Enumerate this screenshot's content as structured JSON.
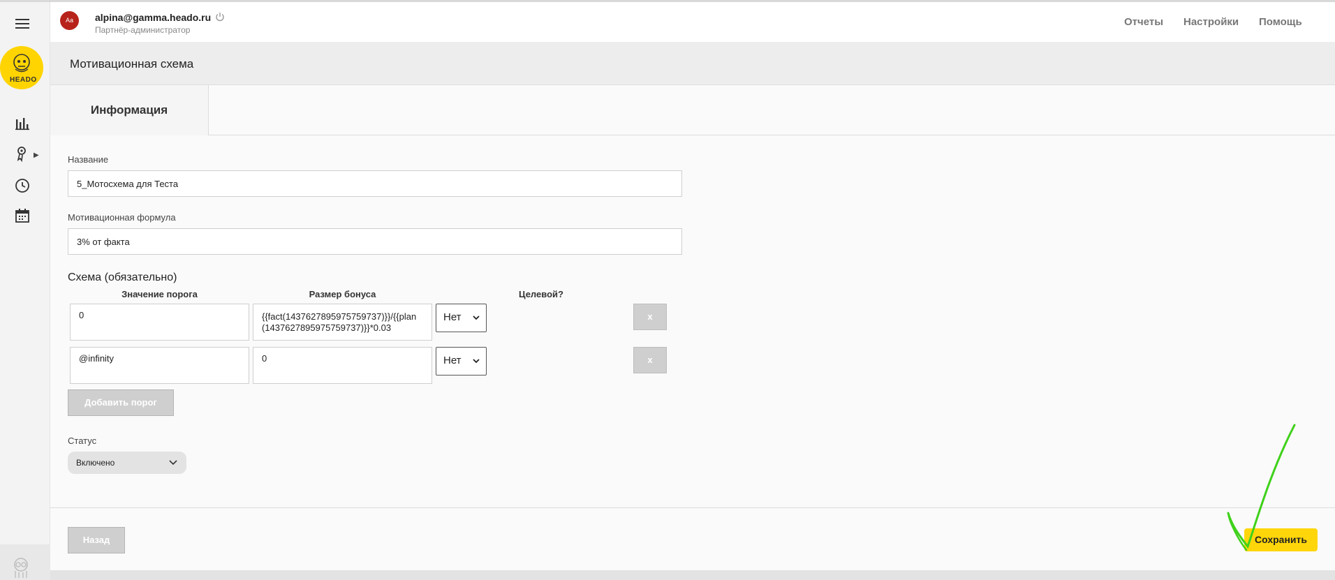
{
  "header": {
    "avatar_initials": "Aa",
    "user_email": "alpina@gamma.heado.ru",
    "user_role": "Партнёр-администратор",
    "nav": [
      {
        "label": "Отчеты"
      },
      {
        "label": "Настройки"
      },
      {
        "label": "Помощь"
      }
    ]
  },
  "sidebar": {
    "logo_text": "HEADO",
    "icons": [
      "menu-icon",
      "bar-chart-icon",
      "award-icon",
      "clock-icon",
      "calendar-icon"
    ]
  },
  "page": {
    "title": "Мотивационная схема",
    "tab": "Информация"
  },
  "form": {
    "name_label": "Название",
    "name_value": "5_Мотосхема для Теста",
    "formula_label": "Мотивационная формула",
    "formula_value": "3% от факта",
    "scheme_title": "Схема (обязательно)",
    "columns": {
      "threshold": "Значение порога",
      "bonus": "Размер бонуса",
      "target": "Целевой?"
    },
    "rows": [
      {
        "threshold": "0",
        "bonus": "{{fact(1437627895975759737)}}/{{plan(1437627895975759737)}}*0.03",
        "target": "Нет",
        "remove": "x"
      },
      {
        "threshold": "@infinity",
        "bonus": "0",
        "target": "Нет",
        "remove": "x"
      }
    ],
    "add_threshold_label": "Добавить порог",
    "status_label": "Статус",
    "status_value": "Включено"
  },
  "footer": {
    "back_label": "Назад",
    "save_label": "Сохранить"
  },
  "colors": {
    "accent": "#ffd60a",
    "annotation": "#3fd11a"
  }
}
